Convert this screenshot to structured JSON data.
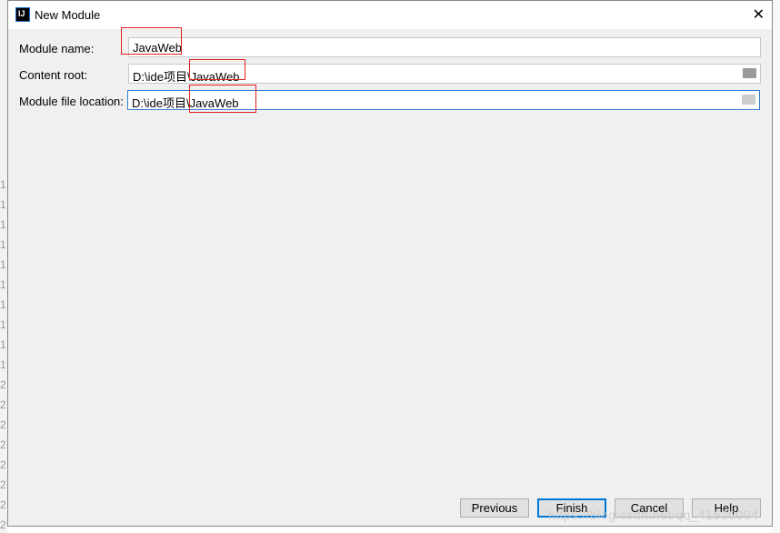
{
  "window": {
    "title": "New Module",
    "app_icon": "intellij-icon"
  },
  "form": {
    "module_name": {
      "label": "Module name:",
      "value": "JavaWeb"
    },
    "content_root": {
      "label": "Content root:",
      "value": "D:\\ide项目\\JavaWeb"
    },
    "module_file_location": {
      "label": "Module file location:",
      "value": "D:\\ide项目\\JavaWeb"
    }
  },
  "buttons": {
    "previous": "Previous",
    "finish": "Finish",
    "cancel": "Cancel",
    "help": "Help"
  },
  "background_line_numbers": [
    "1",
    "1",
    "1",
    "1",
    "1",
    "1",
    "1",
    "1",
    "1",
    "1",
    "2",
    "2",
    "2",
    "2",
    "2",
    "2",
    "2",
    "2"
  ],
  "watermark": "https://blog.csdn.net/qq_41530004",
  "colors": {
    "highlight": "#e01f1f",
    "focus": "#2f7fd6"
  }
}
